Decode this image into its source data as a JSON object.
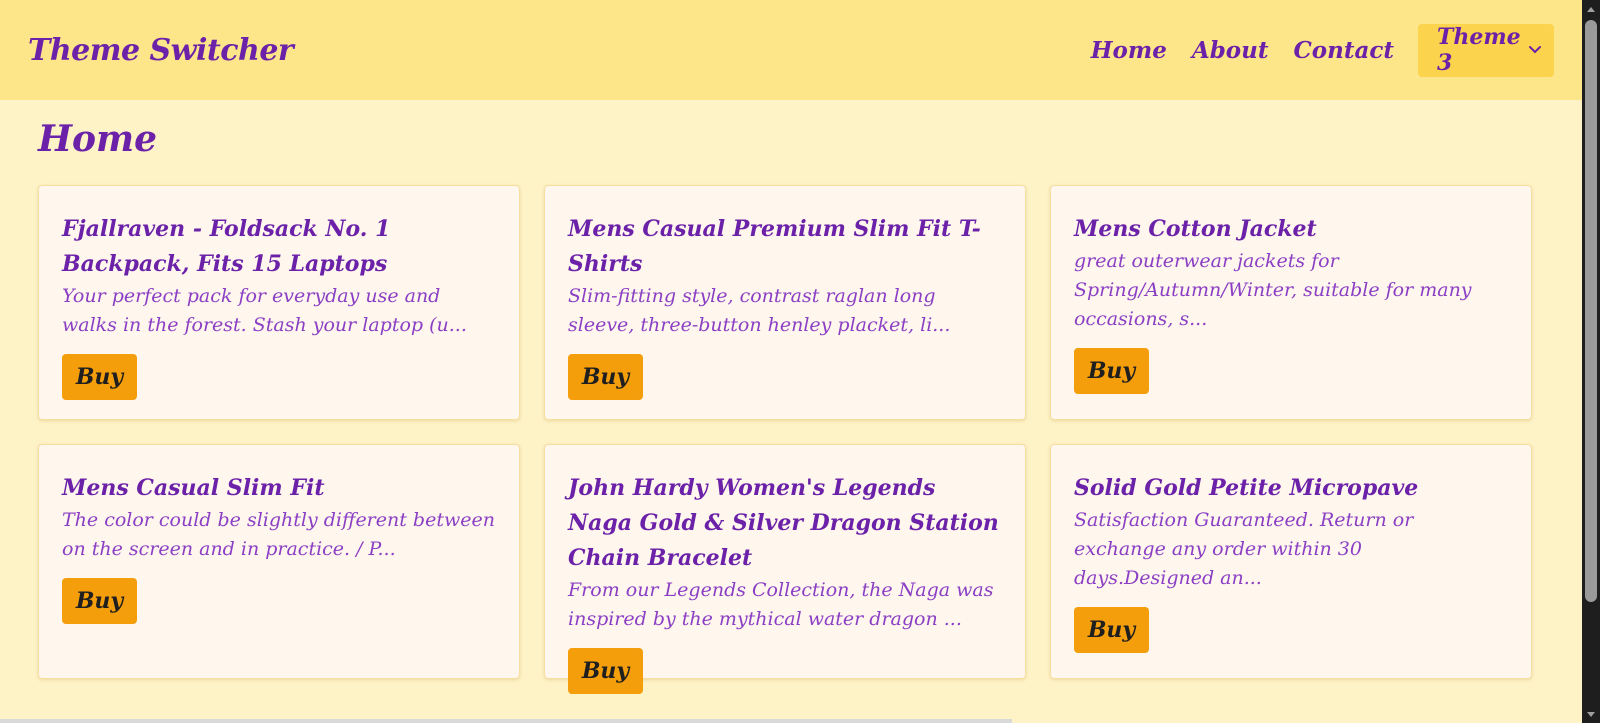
{
  "header": {
    "brand": "Theme Switcher",
    "nav": [
      "Home",
      "About",
      "Contact"
    ],
    "theme_select": {
      "selected": "Theme 3"
    }
  },
  "main": {
    "title": "Home",
    "products": [
      {
        "title": "Fjallraven - Foldsack No. 1 Backpack, Fits 15 Laptops",
        "description": "Your perfect pack for everyday use and walks in the forest. Stash your laptop (u...",
        "button": "Buy"
      },
      {
        "title": "Mens Casual Premium Slim Fit T-Shirts",
        "description": "Slim-fitting style, contrast raglan long sleeve, three-button henley placket, li...",
        "button": "Buy"
      },
      {
        "title": "Mens Cotton Jacket",
        "description": "great outerwear jackets for Spring/Autumn/Winter, suitable for many occasions, s...",
        "button": "Buy"
      },
      {
        "title": "Mens Casual Slim Fit",
        "description": "The color could be slightly different between on the screen and in practice. / P...",
        "button": "Buy"
      },
      {
        "title": "John Hardy Women's Legends Naga Gold & Silver Dragon Station Chain Bracelet",
        "description": "From our Legends Collection, the Naga was inspired by the mythical water dragon ...",
        "button": "Buy"
      },
      {
        "title": "Solid Gold Petite Micropave",
        "description": "Satisfaction Guaranteed. Return or exchange any order within 30 days.Designed an...",
        "button": "Buy"
      }
    ]
  },
  "colors": {
    "header_bg": "#fde68a",
    "page_bg": "#fef3c7",
    "accent_text": "#6b21a8",
    "button_bg": "#f59e0b",
    "card_bg": "#fff7ed"
  }
}
